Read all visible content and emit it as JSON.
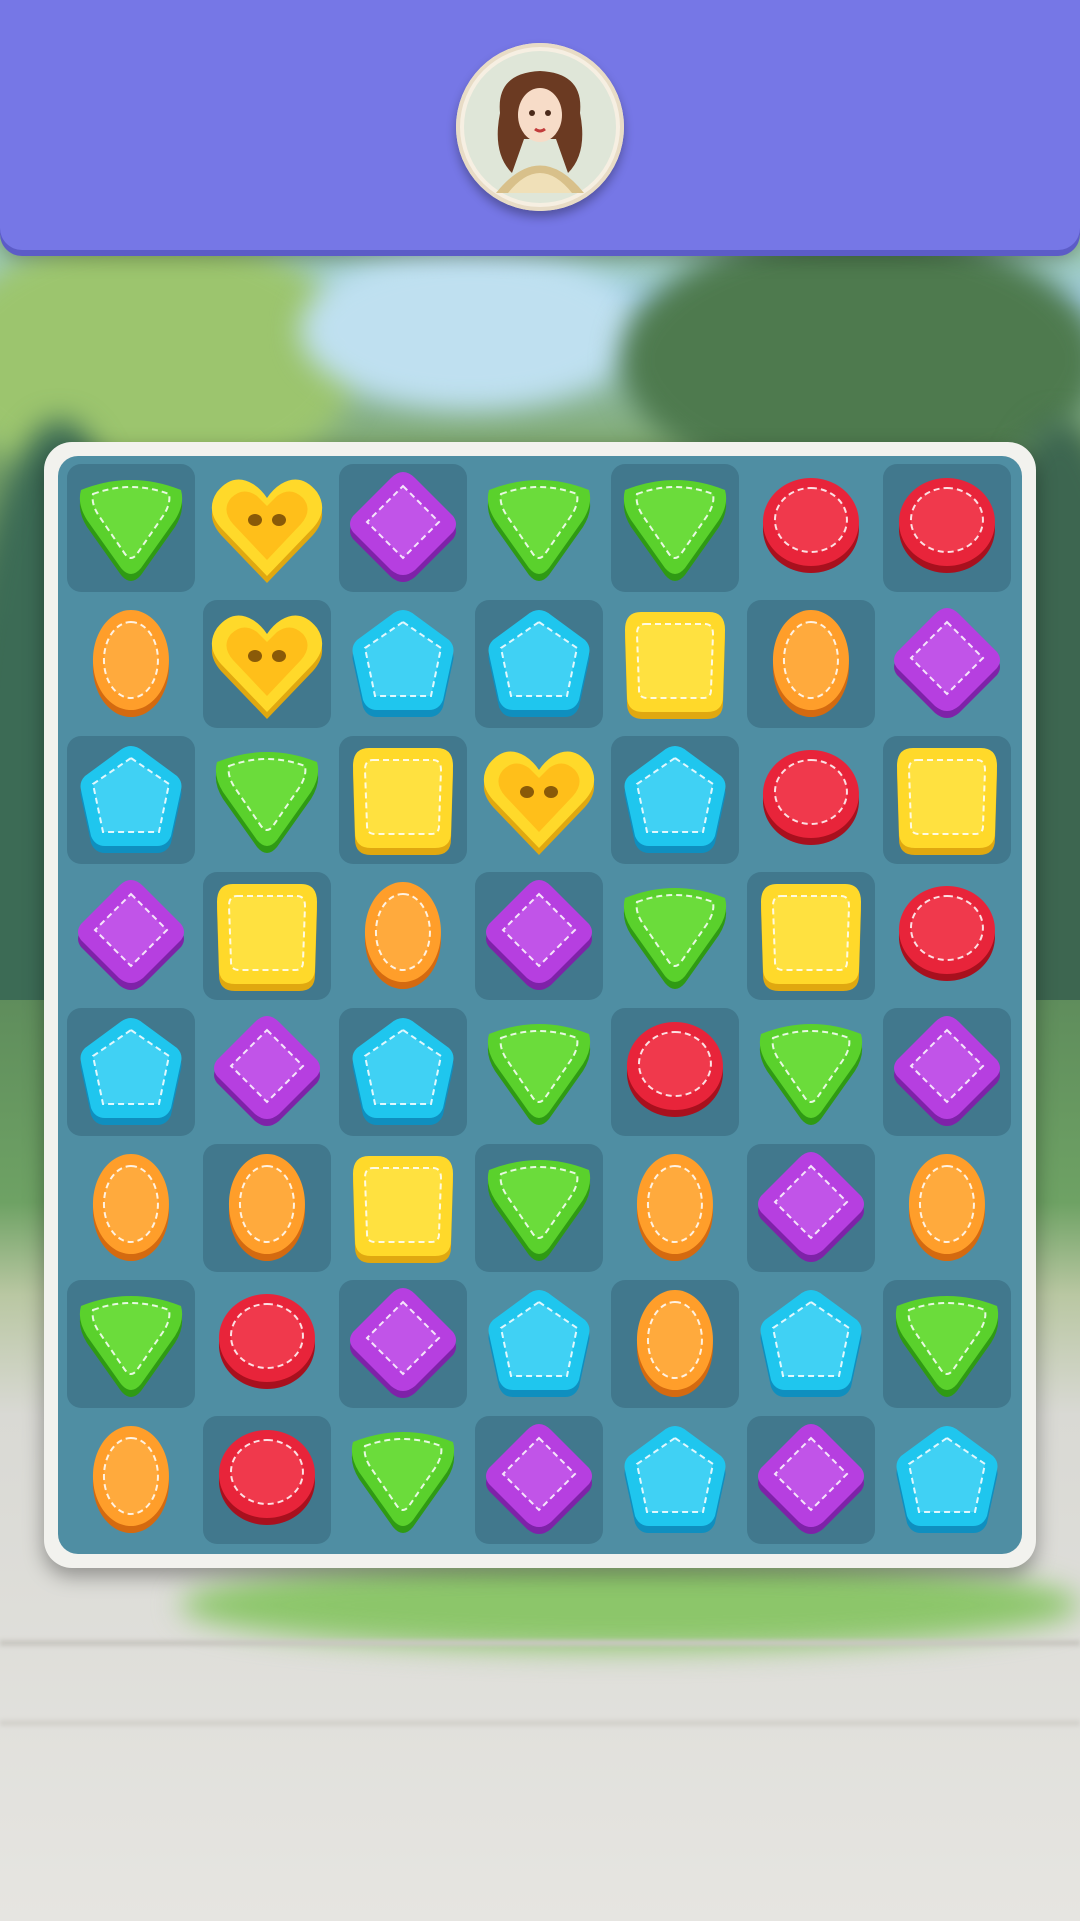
{
  "header": {
    "avatar_icon": "character-portrait-icon",
    "background_color": "#7677e6"
  },
  "board": {
    "rows": 8,
    "cols": 7,
    "tiles": [
      [
        "green-triangle",
        "yellow-heart",
        "purple-diamond",
        "green-triangle",
        "green-triangle",
        "red-circle",
        "red-circle"
      ],
      [
        "orange-oval",
        "yellow-heart",
        "cyan-pentagon",
        "cyan-pentagon",
        "yellow-square",
        "orange-oval",
        "purple-diamond"
      ],
      [
        "cyan-pentagon",
        "green-triangle",
        "yellow-square",
        "yellow-heart",
        "cyan-pentagon",
        "red-circle",
        "yellow-square"
      ],
      [
        "purple-diamond",
        "yellow-square",
        "orange-oval",
        "purple-diamond",
        "green-triangle",
        "yellow-square",
        "red-circle"
      ],
      [
        "cyan-pentagon",
        "purple-diamond",
        "cyan-pentagon",
        "green-triangle",
        "red-circle",
        "green-triangle",
        "purple-diamond"
      ],
      [
        "orange-oval",
        "orange-oval",
        "yellow-square",
        "green-triangle",
        "orange-oval",
        "purple-diamond",
        "orange-oval"
      ],
      [
        "green-triangle",
        "red-circle",
        "purple-diamond",
        "cyan-pentagon",
        "orange-oval",
        "cyan-pentagon",
        "green-triangle"
      ],
      [
        "orange-oval",
        "red-circle",
        "green-triangle",
        "purple-diamond",
        "cyan-pentagon",
        "purple-diamond",
        "cyan-pentagon"
      ]
    ],
    "colors": {
      "green": "#5ad12c",
      "yellow": "#ffd92a",
      "purple": "#b63fe0",
      "red": "#e8243a",
      "orange": "#ff9e2a",
      "cyan": "#1fc6ee"
    }
  }
}
